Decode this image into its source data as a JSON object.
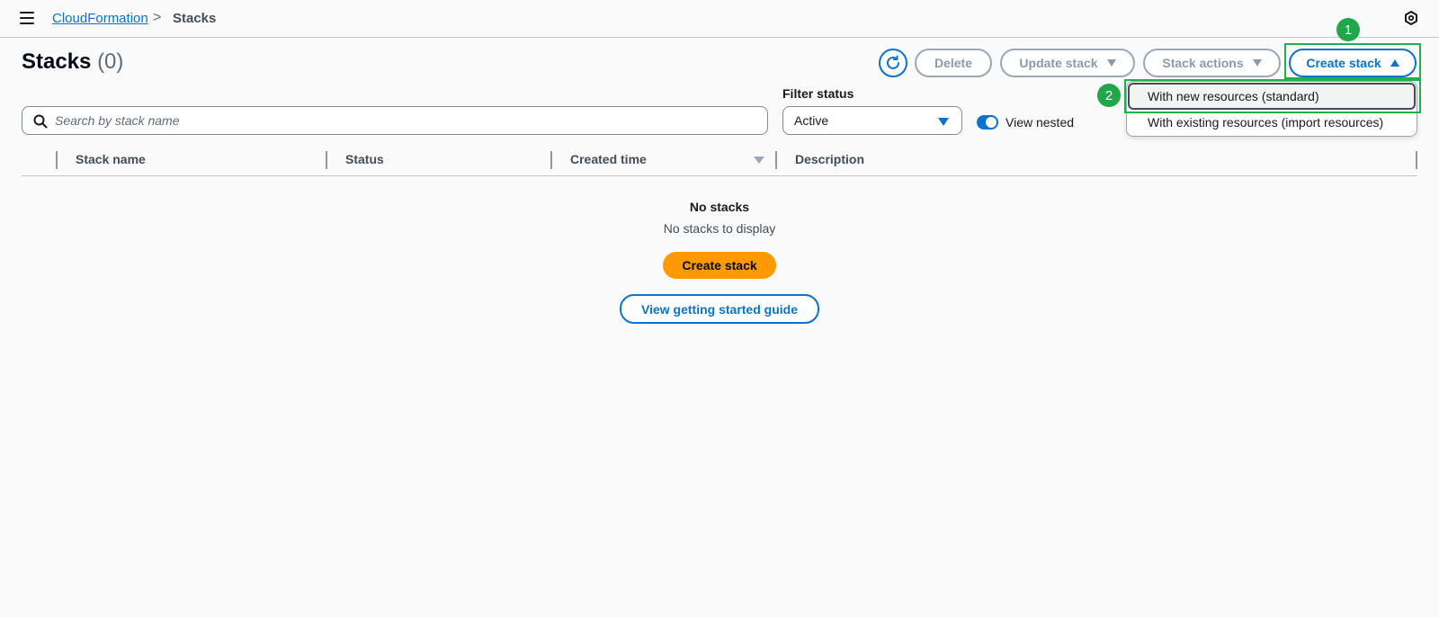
{
  "breadcrumb": {
    "link": "CloudFormation",
    "separator": ">",
    "current": "Stacks"
  },
  "header": {
    "title": "Stacks",
    "count": "(0)"
  },
  "toolbar": {
    "delete_label": "Delete",
    "update_label": "Update stack",
    "actions_label": "Stack actions",
    "create_label": "Create stack"
  },
  "filters": {
    "search_placeholder": "Search by stack name",
    "status_label": "Filter status",
    "status_value": "Active",
    "view_nested_label": "View nested"
  },
  "table": {
    "columns": [
      "Stack name",
      "Status",
      "Created time",
      "Description"
    ]
  },
  "empty_state": {
    "title": "No stacks",
    "subtitle": "No stacks to display",
    "create_label": "Create stack",
    "guide_label": "View getting started guide"
  },
  "create_menu": {
    "items": [
      "With new resources (standard)",
      "With existing resources (import resources)"
    ]
  },
  "annotations": {
    "badge1": "1",
    "badge2": "2"
  },
  "colors": {
    "primary": "#0972d3",
    "orange": "#ff9900",
    "highlight": "#1db34a"
  }
}
